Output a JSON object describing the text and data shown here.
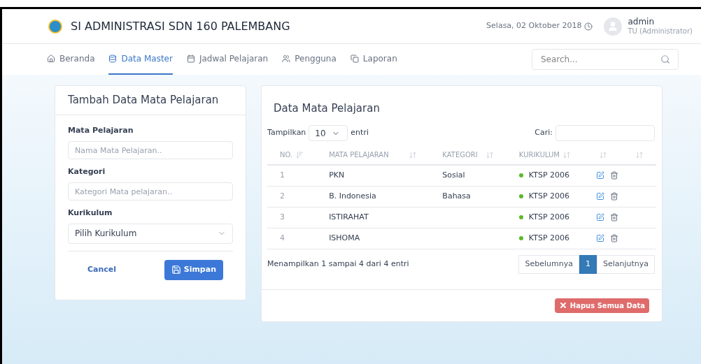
{
  "header": {
    "title": "SI ADMINISTRASI SDN 160 PALEMBANG",
    "date": "Selasa, 02 Oktober 2018",
    "user": {
      "name": "admin",
      "role": "TU (Administrator)"
    }
  },
  "nav": {
    "items": [
      {
        "label": "Beranda",
        "selected": false
      },
      {
        "label": "Data Master",
        "selected": true
      },
      {
        "label": "Jadwal Pelajaran",
        "selected": false
      },
      {
        "label": "Pengguna",
        "selected": false
      },
      {
        "label": "Laporan",
        "selected": false
      }
    ],
    "search": {
      "placeholder": "Search..."
    }
  },
  "form": {
    "title": "Tambah Data Mata Pelajaran",
    "fields": [
      {
        "kind": "input",
        "label": "Mata Pelajaran",
        "placeholder": "Nama Mata Pelajaran.."
      },
      {
        "kind": "input",
        "label": "Kategori",
        "placeholder": "Kategori Mata pelajaran.."
      },
      {
        "kind": "select",
        "label": "Kurikulum",
        "value": "Pilih Kurikulum"
      }
    ],
    "cancel": "Cancel",
    "save": "Simpan"
  },
  "table_panel": {
    "title": "Data Mata Pelajaran",
    "length": {
      "before": "Tampilkan",
      "value": "10",
      "after": "entri"
    },
    "search_label": "Cari:",
    "columns": [
      "NO.",
      "MATA PELAJARAN",
      "KATEGORI",
      "KURIKULUM",
      "",
      ""
    ],
    "rows": [
      {
        "no": "1",
        "name": "PKN",
        "category": "Sosial",
        "curriculum": "KTSP 2006",
        "color": "#5cb82c"
      },
      {
        "no": "2",
        "name": "B. Indonesia",
        "category": "Bahasa",
        "curriculum": "KTSP 2006",
        "color": "#5cb82c"
      },
      {
        "no": "3",
        "name": "ISTIRAHAT",
        "category": "",
        "curriculum": "KTSP 2006",
        "color": "#5cb82c"
      },
      {
        "no": "4",
        "name": "ISHOMA",
        "category": "",
        "curriculum": "KTSP 2006",
        "color": "#5cb82c"
      }
    ],
    "info": "Menampilkan 1 sampai 4 dari 4 entri",
    "pages": [
      {
        "label": "Sebelumnya",
        "selected": false
      },
      {
        "label": "1",
        "selected": true
      },
      {
        "label": "Selanjutnya",
        "selected": false
      }
    ],
    "delete_all": "Hapus Semua Data"
  }
}
